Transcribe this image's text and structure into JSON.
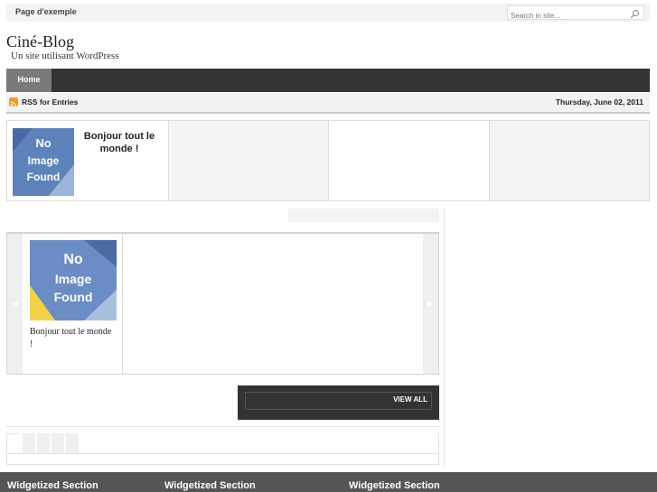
{
  "header": {
    "top_link": "Page d'exemple",
    "search_placeholder": "Search in site...",
    "site_title": "Ciné-Blog",
    "tagline": "Un site utilisant WordPress"
  },
  "nav": {
    "home": "Home"
  },
  "subbar": {
    "rss": "RSS for Entries",
    "date": "Thursday, June 02, 2011"
  },
  "featured": {
    "title": "Bonjour tout le monde !",
    "thumb_lines": [
      "No",
      "Image",
      "Found"
    ]
  },
  "carousel": {
    "prev": "◀",
    "next": "▶",
    "item_title": "Bonjour tout le monde !",
    "thumb_lines": [
      "No",
      "Image",
      "Found"
    ],
    "view_all": "VIEW ALL"
  },
  "footer": {
    "widgets": [
      "Widgetized Section",
      "Widgetized Section",
      "Widgetized Section"
    ]
  },
  "colors": {
    "nav_bg": "#333333",
    "nav_active": "#7a7a7a",
    "footer_bg": "#555555",
    "rss": "#f29b1d"
  }
}
